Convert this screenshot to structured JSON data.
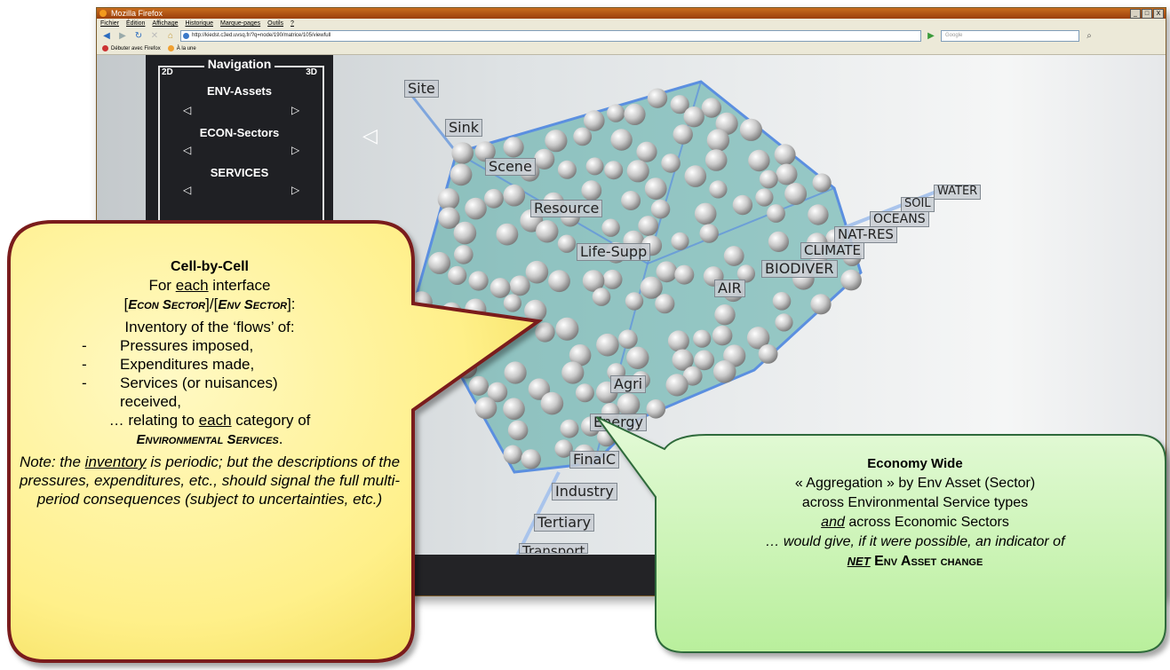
{
  "browser": {
    "title": "Mozilla Firefox",
    "window_buttons": [
      "_",
      "□",
      "X"
    ],
    "menu": [
      "Fichier",
      "Édition",
      "Affichage",
      "Historique",
      "Marque-pages",
      "Outils",
      "?"
    ],
    "url": "http://kiedst.c3ed.uvsq.fr/?q=node/190/matrice/105/viewfull",
    "search_placeholder": "Google",
    "bookmarks": [
      "Débuter avec Firefox",
      "À la une"
    ]
  },
  "navigation": {
    "title": "Navigation",
    "mode_2d": "2D",
    "mode_3d": "3D",
    "groups": [
      "ENV-Assets",
      "ECON-Sectors",
      "SERVICES"
    ],
    "arrow_left": "◁",
    "arrow_right": "▷"
  },
  "lattice_labels": {
    "service_axis": [
      "Site",
      "Sink",
      "Scene",
      "Resource",
      "Life-Supp"
    ],
    "asset_axis": [
      "WATER",
      "SOIL",
      "OCEANS",
      "NAT-RES",
      "CLIMATE",
      "BIODIVER",
      "AIR"
    ],
    "sector_axis": [
      "Agri",
      "Energy",
      "FinalC",
      "Industry",
      "Tertiary",
      "Transport"
    ]
  },
  "colors": {
    "lattice_fill": "#4fa8a3",
    "lattice_edge": "#5b8fe0",
    "bubble_yellow": "#fff4a0",
    "bubble_yellow_border": "#7a1a1a",
    "bubble_green": "#ccf5b6",
    "bubble_green_border": "#2f6a3a"
  },
  "callout_cell": {
    "heading": "Cell-by-Cell",
    "line1_pre": "For ",
    "line1_u": "each",
    "line1_post": " interface",
    "line2_a": "[",
    "line2_econ": "Econ Sector",
    "line2_mid": "]/[",
    "line2_env": "Env Sector",
    "line2_end": "]:",
    "inventory": "Inventory of the ‘flows’ of:",
    "items": [
      "Pressures imposed,",
      "Expenditures made,",
      "Services (or nuisances) received,"
    ],
    "item_dash": "-",
    "relating_pre": "… relating to ",
    "relating_u": "each",
    "relating_post": " category of",
    "env_services": "Environmental Services",
    "env_services_end": ".",
    "note_pre": "Note: the ",
    "note_u": "inventory",
    "note_post": " is periodic; but the descriptions of the pressures, expenditures, etc., should signal the full multi-period consequences (subject to uncertainties, etc.)"
  },
  "callout_economy": {
    "heading": "Economy Wide",
    "line1": "« Aggregation » by Env Asset (Sector)",
    "line2": "across Environmental Service types",
    "line3_u": "and",
    "line3_post": " across Economic Sectors",
    "line4": "… would give, if it were possible, an indicator of",
    "net": "net",
    "net_post": " Env Asset change"
  }
}
